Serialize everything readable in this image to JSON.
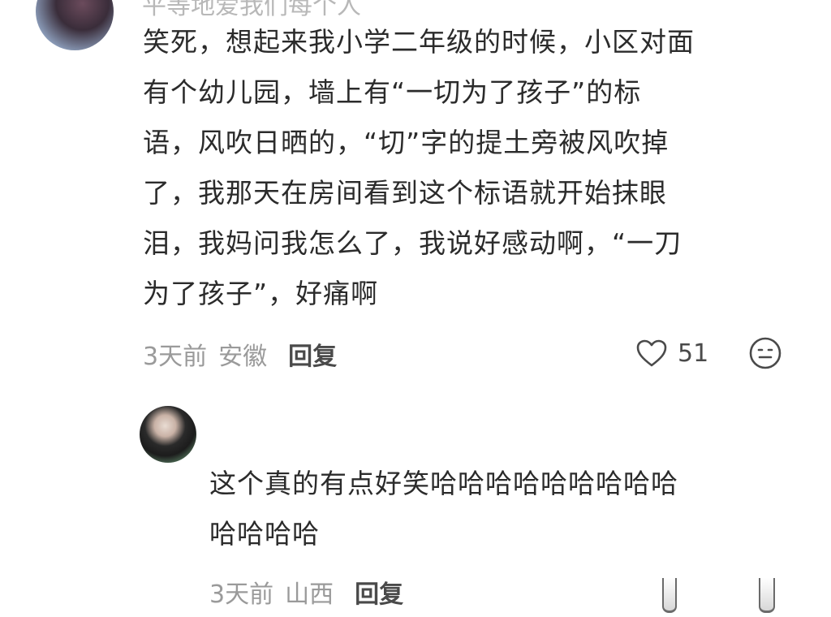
{
  "comment": {
    "author_cutoff": "平等地爱我们每个人",
    "lines": [
      "笑死，想起来我小学二年级的时候，小区对面",
      "有个幼儿园，墙上有“一切为了孩子”的标",
      "语，风吹日晒的，“切”字的提土旁被风吹掉",
      "了，我那天在房间看到这个标语就开始抹眼",
      "泪，我妈问我怎么了，我说好感动啊，“一刀",
      "为了孩子”，好痛啊"
    ],
    "time": "3天前",
    "location": "安徽",
    "reply_label": "回复",
    "like_count": "51",
    "like_icon": "heart-outline-icon",
    "emoji_icon": "smiley-face-icon"
  },
  "reply": {
    "lines": [
      "这个真的有点好笑哈哈哈哈哈哈哈哈哈",
      "哈哈哈哈"
    ],
    "time": "3天前",
    "location": "山西",
    "reply_label": "回复"
  },
  "colors": {
    "text": "#2b2b2b",
    "meta": "#9a9a9a",
    "background": "#ffffff"
  }
}
